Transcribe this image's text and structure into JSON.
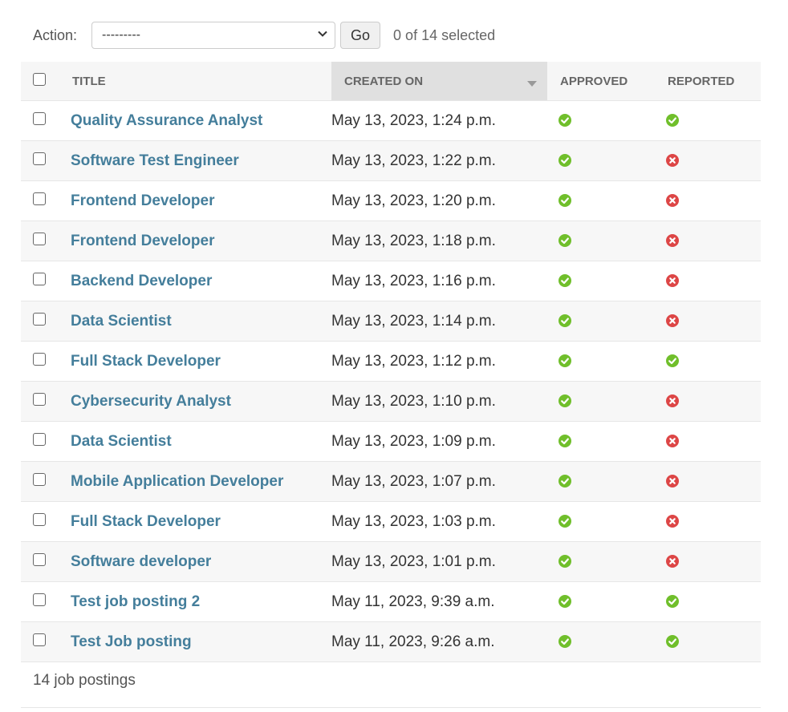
{
  "actions": {
    "label": "Action:",
    "select_value": "---------",
    "go_label": "Go",
    "selection_count": "0 of 14 selected"
  },
  "table": {
    "columns": [
      "TITLE",
      "CREATED ON",
      "APPROVED",
      "REPORTED"
    ],
    "sorted_column": "CREATED ON",
    "rows": [
      {
        "title": "Quality Assurance Analyst",
        "created_on": "May 13, 2023, 1:24 p.m.",
        "approved": true,
        "reported": true
      },
      {
        "title": "Software Test Engineer",
        "created_on": "May 13, 2023, 1:22 p.m.",
        "approved": true,
        "reported": false
      },
      {
        "title": "Frontend Developer",
        "created_on": "May 13, 2023, 1:20 p.m.",
        "approved": true,
        "reported": false
      },
      {
        "title": "Frontend Developer",
        "created_on": "May 13, 2023, 1:18 p.m.",
        "approved": true,
        "reported": false
      },
      {
        "title": "Backend Developer",
        "created_on": "May 13, 2023, 1:16 p.m.",
        "approved": true,
        "reported": false
      },
      {
        "title": "Data Scientist",
        "created_on": "May 13, 2023, 1:14 p.m.",
        "approved": true,
        "reported": false
      },
      {
        "title": "Full Stack Developer",
        "created_on": "May 13, 2023, 1:12 p.m.",
        "approved": true,
        "reported": true
      },
      {
        "title": "Cybersecurity Analyst",
        "created_on": "May 13, 2023, 1:10 p.m.",
        "approved": true,
        "reported": false
      },
      {
        "title": "Data Scientist",
        "created_on": "May 13, 2023, 1:09 p.m.",
        "approved": true,
        "reported": false
      },
      {
        "title": "Mobile Application Developer",
        "created_on": "May 13, 2023, 1:07 p.m.",
        "approved": true,
        "reported": false
      },
      {
        "title": "Full Stack Developer",
        "created_on": "May 13, 2023, 1:03 p.m.",
        "approved": true,
        "reported": false
      },
      {
        "title": "Software developer",
        "created_on": "May 13, 2023, 1:01 p.m.",
        "approved": true,
        "reported": false
      },
      {
        "title": "Test job posting 2",
        "created_on": "May 11, 2023, 9:39 a.m.",
        "approved": true,
        "reported": true
      },
      {
        "title": "Test Job posting",
        "created_on": "May 11, 2023, 9:26 a.m.",
        "approved": true,
        "reported": true
      }
    ]
  },
  "footer": {
    "count_text": "14 job postings"
  },
  "colors": {
    "link": "#447e9b",
    "yes": "#70bf2b",
    "no": "#dd4646"
  },
  "icons": {
    "yes": "check-circle-icon",
    "no": "x-circle-icon",
    "sort": "sort-descending-icon",
    "dropdown": "chevron-down-icon"
  }
}
